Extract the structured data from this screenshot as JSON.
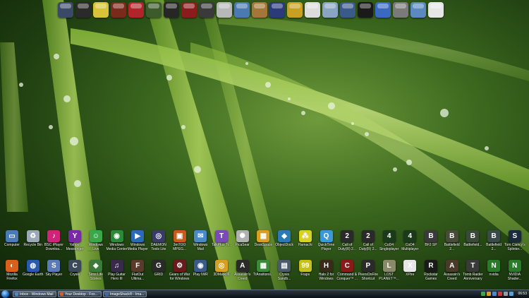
{
  "dock": {
    "icons": [
      {
        "name": "blue-orb-icon",
        "color": "#3a4a66"
      },
      {
        "name": "top-hat-icon",
        "color": "#2a2a2a"
      },
      {
        "name": "smiley-face-icon",
        "color": "#d8c23a"
      },
      {
        "name": "game-warrior-icon",
        "color": "#7a2a1a"
      },
      {
        "name": "red-box-icon",
        "color": "#b0242a"
      },
      {
        "name": "green-screen-icon",
        "color": "#3d5a2a"
      },
      {
        "name": "dark-game-icon",
        "color": "#262626"
      },
      {
        "name": "gears-icon",
        "color": "#8a1c1c"
      },
      {
        "name": "media-player-icon",
        "color": "#3a3a3a"
      },
      {
        "name": "silver-hat-icon",
        "color": "#b8b8b8"
      },
      {
        "name": "explorer-icon",
        "color": "#4c7ab0"
      },
      {
        "name": "person-icon",
        "color": "#a5763a"
      },
      {
        "name": "wizard-hat-icon",
        "color": "#2a3a7a"
      },
      {
        "name": "gold-ball-icon",
        "color": "#c8a022"
      },
      {
        "name": "paper-icon",
        "color": "#dcdcdc"
      },
      {
        "name": "documents-icon",
        "color": "#8aa4c4"
      },
      {
        "name": "network-icon",
        "color": "#3a5a8a"
      },
      {
        "name": "black-hat-icon",
        "color": "#1a1a1a"
      },
      {
        "name": "calendar-icon",
        "color": "#3a6ac0"
      },
      {
        "name": "trash-icon",
        "color": "#7a7a7a"
      },
      {
        "name": "settings-icon",
        "color": "#5a8ac0"
      },
      {
        "name": "clock-icon",
        "color": "#e6e6e6"
      }
    ]
  },
  "desktop": {
    "row1": [
      {
        "label": "Computer",
        "color": "#4a7ab8",
        "glyph": "▭"
      },
      {
        "label": "Recycle Bin",
        "color": "#9aa8b8",
        "glyph": "♻"
      },
      {
        "label": "BSC iPlayer Downloa...",
        "color": "#d0247a",
        "glyph": "♪"
      },
      {
        "label": "Yahoo! Messenger",
        "color": "#7a2aa8",
        "glyph": "Y"
      },
      {
        "label": "Windows Live Messen...",
        "color": "#3aa84a",
        "glyph": "☺"
      },
      {
        "label": "Windows Media Center",
        "color": "#2a8a3a",
        "glyph": "◉"
      },
      {
        "label": "Windows Media Player",
        "color": "#2a6ab8",
        "glyph": "▶"
      },
      {
        "label": "DAEMON Tools Lite",
        "color": "#3a3a6a",
        "glyph": "◎"
      },
      {
        "label": "3mTOO MPEG...",
        "color": "#c85a1a",
        "glyph": "▣"
      },
      {
        "label": "Windows Mail",
        "color": "#4a8ac8",
        "glyph": "✉"
      },
      {
        "label": "TalkPlus Tr...",
        "color": "#7a4ab8",
        "glyph": "T"
      },
      {
        "label": "PicaSear",
        "color": "#b0b0b0",
        "glyph": "✺"
      },
      {
        "label": "DeskSpace",
        "color": "#d8a022",
        "glyph": "▦"
      },
      {
        "label": "ObjectDock",
        "color": "#2a7ab8",
        "glyph": "◆"
      },
      {
        "label": "Hamachi",
        "color": "#d8d022",
        "glyph": "⁂"
      },
      {
        "label": "QuickTime Player",
        "color": "#3a9ad8",
        "glyph": "Q"
      },
      {
        "label": "Call of Duty(R) 2...",
        "color": "#2a2a2a",
        "glyph": "2"
      },
      {
        "label": "Call of Duty(R) 2...",
        "color": "#2a2a2a",
        "glyph": "2"
      },
      {
        "label": "CoD4 Singleplayer",
        "color": "#1a3a1a",
        "glyph": "4"
      },
      {
        "label": "CoD4 Multiplayer",
        "color": "#1a3a1a",
        "glyph": "4"
      },
      {
        "label": "BF2 SP",
        "color": "#3a3a3a",
        "glyph": "B"
      },
      {
        "label": "Battlefield 2...",
        "color": "#4a4a3a",
        "glyph": "B"
      },
      {
        "label": "Battlefield...",
        "color": "#3a4a3a",
        "glyph": "B"
      },
      {
        "label": "Battlefield 2...",
        "color": "#3a4a4a",
        "glyph": "B"
      },
      {
        "label": "Tom Clancy's Splinter...",
        "color": "#1a2a3a",
        "glyph": "S"
      }
    ],
    "row2": [
      {
        "label": "Mozilla Firefox",
        "color": "#d8601a",
        "glyph": "◐"
      },
      {
        "label": "Google Earth",
        "color": "#2a5ab0",
        "glyph": "◍"
      },
      {
        "label": "Sky Player",
        "color": "#5a7ab8",
        "glyph": "S"
      },
      {
        "label": "Crysis",
        "color": "#3a4a5a",
        "glyph": "C"
      },
      {
        "label": "Sims Life Stories",
        "color": "#3a7a3a",
        "glyph": "◈"
      },
      {
        "label": "Play Guitar Hero III",
        "color": "#3a2a4a",
        "glyph": "♫"
      },
      {
        "label": "FlatOut Ultima...",
        "color": "#5a3a2a",
        "glyph": "F"
      },
      {
        "label": "GRID",
        "color": "#2a2a2a",
        "glyph": "G"
      },
      {
        "label": "Gears of War for Windows",
        "color": "#6a1a1a",
        "glyph": "⚙"
      },
      {
        "label": "Play IWR",
        "color": "#3a5a8a",
        "glyph": "◉"
      },
      {
        "label": "3DMark06",
        "color": "#d8a022",
        "glyph": "◎"
      },
      {
        "label": "Assassin's Creed",
        "color": "#2a2a2a",
        "glyph": "A"
      },
      {
        "label": "TrAnsitions...",
        "color": "#3a8a3a",
        "glyph": "▦"
      },
      {
        "label": "Crysis Sandb...",
        "color": "#4a5a6a",
        "glyph": "▤"
      },
      {
        "label": "Fraps",
        "color": "#c8c01a",
        "glyph": "99"
      },
      {
        "label": "Halo 2 for Windows",
        "color": "#3a2a1a",
        "glyph": "H"
      },
      {
        "label": "Command & Conquer™ ...",
        "color": "#8a1a1a",
        "glyph": "C"
      },
      {
        "label": "PeersOnFire Shortcut",
        "color": "#2a2a2a",
        "glyph": "P"
      },
      {
        "label": "LOST PLANET™...",
        "color": "#8a8a6a",
        "glyph": "L"
      },
      {
        "label": "XPire",
        "color": "#e6e6e6",
        "glyph": "X"
      },
      {
        "label": "Rockstar Games Soc...",
        "color": "#1a1a1a",
        "glyph": "R"
      },
      {
        "label": "Assassin's Creed",
        "color": "#4a3a2a",
        "glyph": "A"
      },
      {
        "label": "Tomb Raider Anniversary",
        "color": "#3a3a3a",
        "glyph": "T"
      },
      {
        "label": "nvidia",
        "color": "#2a7a2a",
        "glyph": "N"
      },
      {
        "label": "NVIDIA Shader...",
        "color": "#2a7a2a",
        "glyph": "N"
      }
    ]
  },
  "taskbar": {
    "buttons": [
      {
        "label": "Inbox - Windows Mail",
        "color": "#4a8ac8"
      },
      {
        "label": "Your Desktop - Fox...",
        "color": "#d8601a"
      },
      {
        "label": "ImageShack® - Ima...",
        "color": "#3a6ab0"
      }
    ],
    "tray_colors": [
      "#3aa84a",
      "#d8a022",
      "#4a8ac8",
      "#c83a3a",
      "#9a9a9a",
      "#5aa0d8"
    ],
    "clock": "06:53"
  }
}
